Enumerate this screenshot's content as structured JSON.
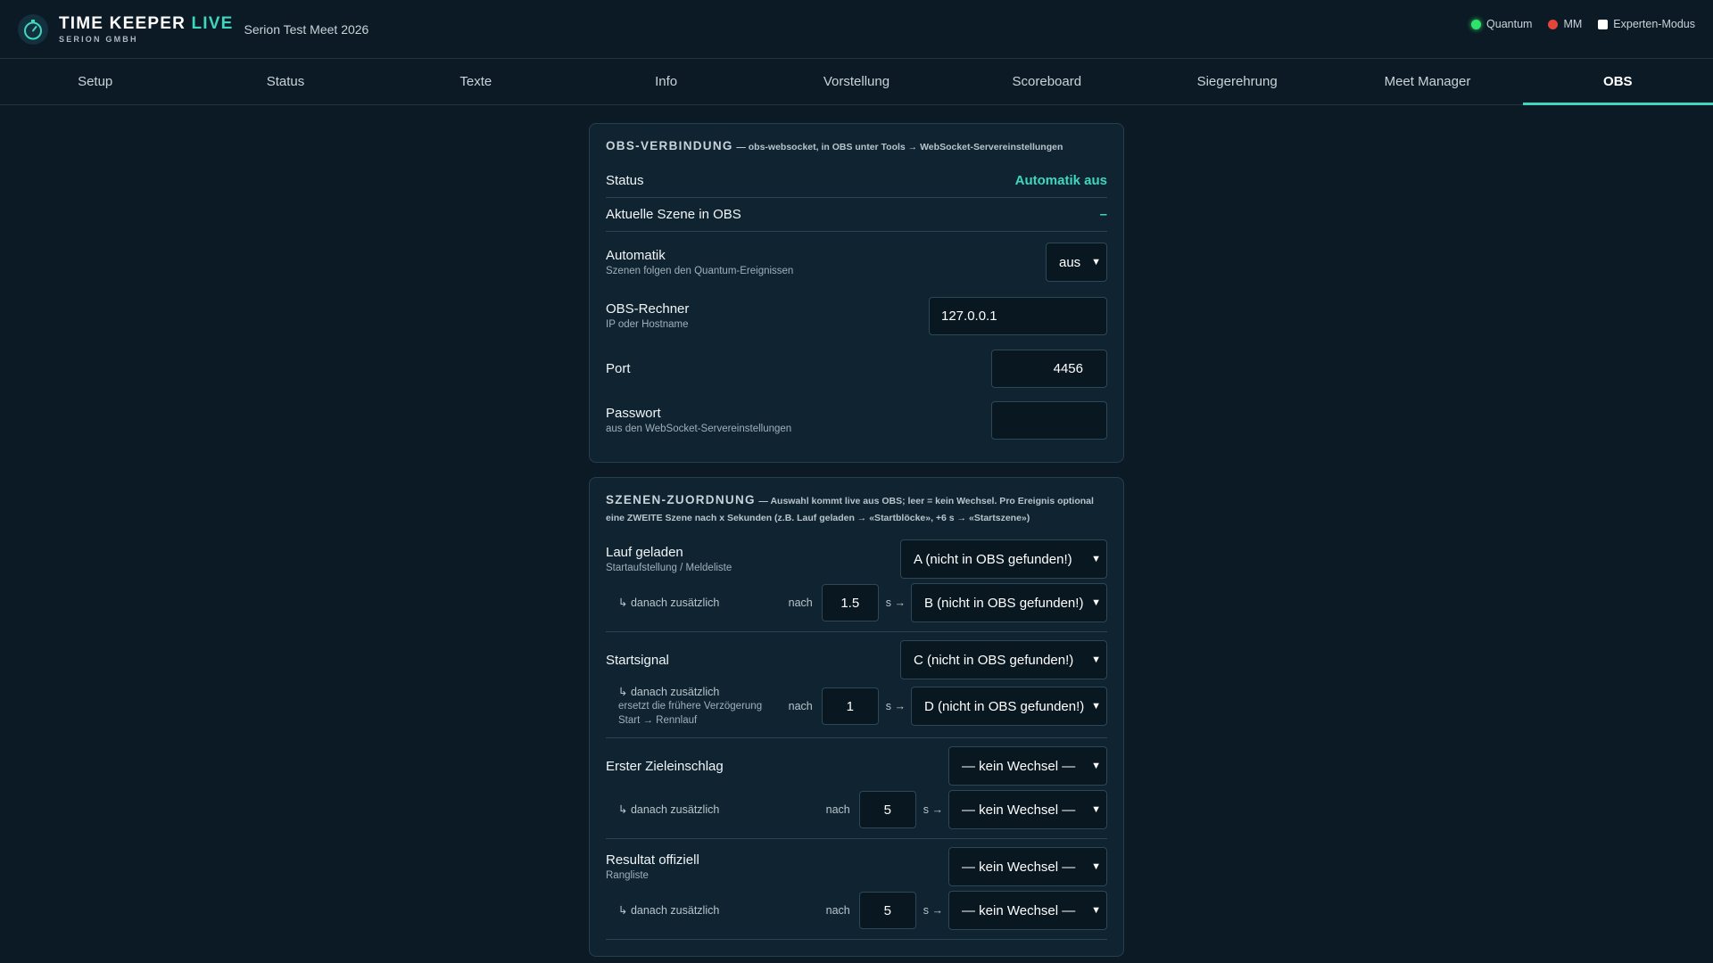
{
  "header": {
    "brand_main": "TIME KEEPER",
    "brand_live": "LIVE",
    "brand_sub": "SERION GMBH",
    "meet_name": "Serion Test Meet 2026",
    "indicators": [
      {
        "label": "Quantum",
        "status": "green"
      },
      {
        "label": "MM",
        "status": "red"
      }
    ],
    "expert_mode_label": "Experten-Modus"
  },
  "nav": {
    "tabs": [
      {
        "label": "Setup"
      },
      {
        "label": "Status"
      },
      {
        "label": "Texte"
      },
      {
        "label": "Info"
      },
      {
        "label": "Vorstellung"
      },
      {
        "label": "Scoreboard"
      },
      {
        "label": "Siegerehrung"
      },
      {
        "label": "Meet Manager"
      },
      {
        "label": "OBS"
      }
    ],
    "active": "OBS"
  },
  "obs_connection": {
    "title": "OBS-VERBINDUNG",
    "hint": "— obs-websocket, in OBS unter Tools → WebSocket-Servereinstellungen",
    "status_label": "Status",
    "status_value": "Automatik aus",
    "scene_label": "Aktuelle Szene in OBS",
    "scene_value": "–",
    "automatik_label": "Automatik",
    "automatik_sub": "Szenen folgen den Quantum-Ereignissen",
    "automatik_value": "aus",
    "host_label": "OBS-Rechner",
    "host_sub": "IP oder Hostname",
    "host_value": "127.0.0.1",
    "port_label": "Port",
    "port_value": "4456",
    "password_label": "Passwort",
    "password_sub": "aus den WebSocket-Servereinstellungen",
    "password_value": ""
  },
  "scene_mapping": {
    "title": "SZENEN-ZUORDNUNG",
    "hint": "— Auswahl kommt live aus OBS; leer = kein Wechsel. Pro Ereignis optional eine ZWEITE Szene nach x Sekunden (z.B. Lauf geladen → «Startblöcke», +6 s → «Startszene»)",
    "followup_label": "↳ danach zusätzlich",
    "nach_label": "nach",
    "s_label": "s →",
    "events": [
      {
        "label": "Lauf geladen",
        "sub": "Startaufstellung / Meldeliste",
        "scene": "A (nicht in OBS gefunden!)",
        "followup_note": "",
        "delay": "1.5",
        "second_scene": "B (nicht in OBS gefunden!)"
      },
      {
        "label": "Startsignal",
        "sub": "",
        "scene": "C (nicht in OBS gefunden!)",
        "followup_note": "ersetzt die frühere Verzögerung Start → Rennlauf",
        "delay": "1",
        "second_scene": "D (nicht in OBS gefunden!)"
      },
      {
        "label": "Erster Zieleinschlag",
        "sub": "",
        "scene": "— kein Wechsel —",
        "followup_note": "",
        "delay": "5",
        "second_scene": "— kein Wechsel —"
      },
      {
        "label": "Resultat offiziell",
        "sub": "Rangliste",
        "scene": "— kein Wechsel —",
        "followup_note": "",
        "delay": "5",
        "second_scene": "— kein Wechsel —"
      }
    ]
  },
  "colors": {
    "background": "#0b1a24",
    "card": "#0f2430",
    "accent": "#3fd6c0",
    "status_green": "#2ee36b",
    "status_red": "#e4453a"
  }
}
